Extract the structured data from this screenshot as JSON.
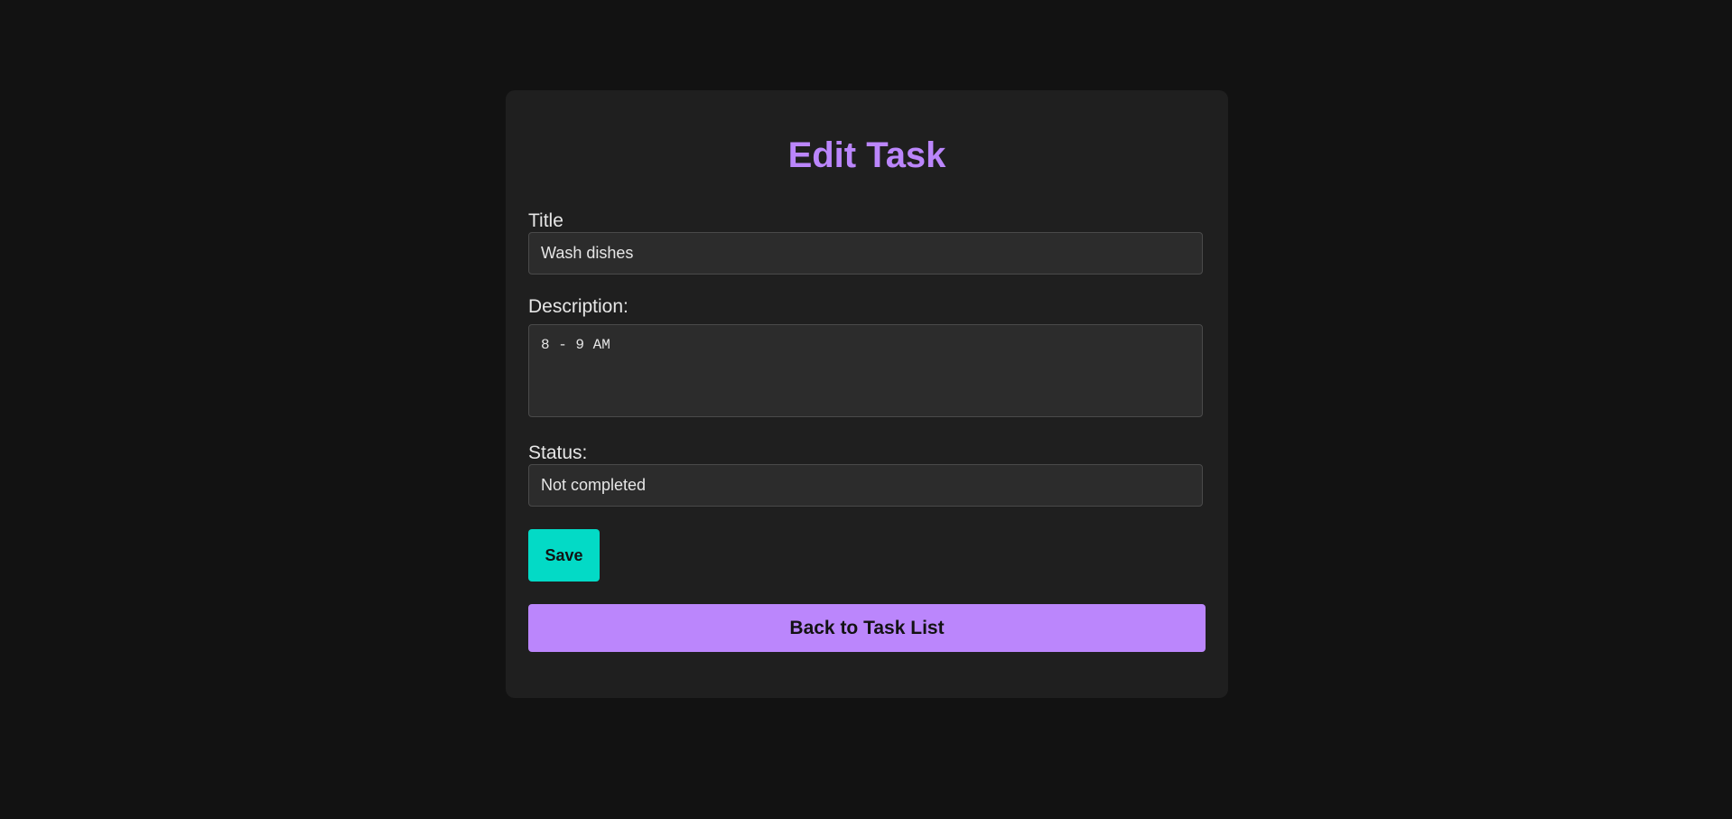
{
  "page": {
    "title": "Edit Task"
  },
  "form": {
    "title_label": "Title",
    "title_value": "Wash dishes",
    "description_label": "Description:",
    "description_value": "8 - 9 AM",
    "status_label": "Status:",
    "status_value": "Not completed",
    "save_label": "Save"
  },
  "nav": {
    "back_label": "Back to Task List"
  },
  "colors": {
    "background": "#121212",
    "card": "#1f1f1f",
    "accent_purple": "#bb86fc",
    "accent_teal": "#03dac6"
  }
}
